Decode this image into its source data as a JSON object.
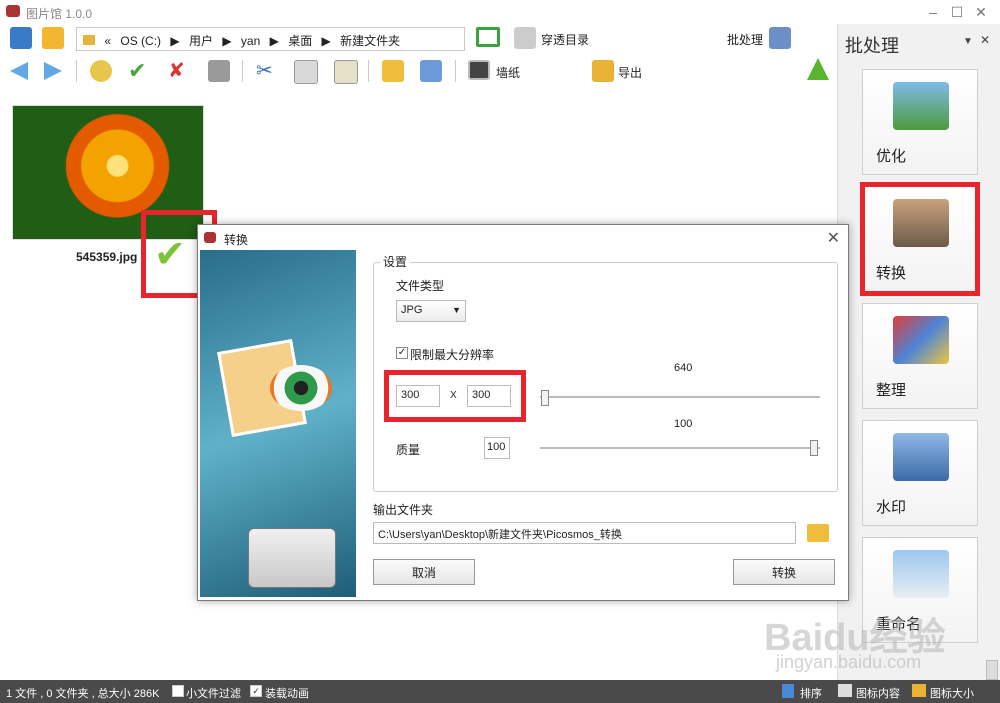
{
  "app": {
    "title": "图片馆 1.0.0"
  },
  "toolbar": {
    "path": [
      "«",
      "OS (C:)",
      "用户",
      "yan",
      "桌面",
      "新建文件夹"
    ],
    "through_dir": "穿透目录",
    "batch": "批处理",
    "wallpaper": "墙纸",
    "export": "导出"
  },
  "content": {
    "thumb_name": "545359.jpg"
  },
  "panel": {
    "title": "批处理",
    "items": [
      {
        "label": "优化"
      },
      {
        "label": "转换"
      },
      {
        "label": "整理"
      },
      {
        "label": "水印"
      },
      {
        "label": "重命名"
      }
    ]
  },
  "dialog": {
    "title": "转换",
    "group": "设置",
    "file_type_label": "文件类型",
    "file_type_value": "JPG",
    "limit_label": "限制最大分辨率",
    "limit_checked": true,
    "width": "300",
    "x_sep": "X",
    "height": "300",
    "res_value": "640",
    "quality_label": "质量",
    "quality_field": "100",
    "quality_value": "100",
    "output_label": "输出文件夹",
    "output_path": "C:\\Users\\yan\\Desktop\\新建文件夹\\Picosmos_转换",
    "cancel": "取消",
    "convert": "转换"
  },
  "status": {
    "summary": "1 文件 , 0 文件夹 , 总大小 286K",
    "small_filter": "小文件过滤",
    "load_anim": "装载动画",
    "load_anim_checked": true,
    "sort": "排序",
    "icon_content": "图标内容",
    "icon_size": "图标大小"
  },
  "colors": {
    "highlight": "#e8252c",
    "statusbar": "#4a4a4a"
  },
  "watermark": {
    "brand": "Baidu经验",
    "url": "jingyan.baidu.com"
  }
}
